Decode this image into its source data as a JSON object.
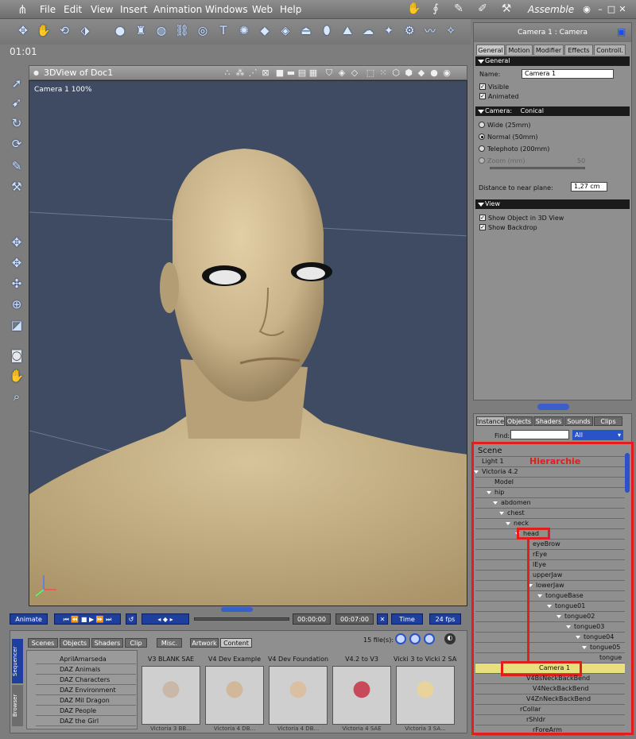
{
  "app": {
    "menu": [
      "File",
      "Edit",
      "View",
      "Insert",
      "Animation",
      "Windows",
      "Web",
      "Help"
    ],
    "room_label": "Assemble",
    "timecode": "01:01"
  },
  "viewport": {
    "title": "3DView of Doc1",
    "camera_label": "Camera 1 100%"
  },
  "properties": {
    "title": "Camera 1 : Camera",
    "tabs": [
      "General",
      "Motion",
      "Modifier",
      "Effects",
      "Controll."
    ],
    "general_section": "General",
    "name_label": "Name:",
    "name_value": "Camera 1",
    "visible_label": "Visible",
    "animated_label": "Animated",
    "camera_section": "Camera:",
    "camera_type": "Conical",
    "lens_options": [
      "Wide (25mm)",
      "Normal (50mm)",
      "Telephoto (200mm)",
      "Zoom (mm)"
    ],
    "zoom_value": "50",
    "near_plane_label": "Distance to near plane:",
    "near_plane_value": "1,27 cm",
    "view_section": "View",
    "show_object_label": "Show Object in 3D View",
    "show_backdrop_label": "Show Backdrop"
  },
  "browser": {
    "tabs": [
      "Instance",
      "Objects",
      "Shaders",
      "Sounds",
      "Clips"
    ],
    "find_label": "Find:",
    "filter_value": "All",
    "annotation": "Hierarchie",
    "tree": [
      {
        "label": "Scene"
      },
      {
        "label": "Light 1"
      },
      {
        "label": "Victoria 4.2"
      },
      {
        "label": "Model"
      },
      {
        "label": "hip"
      },
      {
        "label": "abdomen"
      },
      {
        "label": "chest"
      },
      {
        "label": "neck"
      },
      {
        "label": "head"
      },
      {
        "label": "eyeBrow"
      },
      {
        "label": "rEye"
      },
      {
        "label": "lEye"
      },
      {
        "label": "upperJaw"
      },
      {
        "label": "lowerJaw"
      },
      {
        "label": "tongueBase"
      },
      {
        "label": "tongue01"
      },
      {
        "label": "tongue02"
      },
      {
        "label": "tongue03"
      },
      {
        "label": "tongue04"
      },
      {
        "label": "tongue05"
      },
      {
        "label": "tongue"
      },
      {
        "label": "Camera 1"
      },
      {
        "label": "V4BsNeckBackBend"
      },
      {
        "label": "V4NeckBackBend"
      },
      {
        "label": "V4ZnNeckBackBend"
      },
      {
        "label": "rCollar"
      },
      {
        "label": "rShldr"
      },
      {
        "label": "rForeArm"
      }
    ]
  },
  "timeline": {
    "animate_label": "Animate",
    "current_time": "00:00:00",
    "end_time": "00:07:00",
    "mode": "Time",
    "fps": "24 fps"
  },
  "content": {
    "tabs": [
      "Scenes",
      "Objects",
      "Shaders",
      "Clip",
      "Misc.",
      "Artwork",
      "Content"
    ],
    "file_count": "15 file(s):",
    "side_tabs": [
      "Sequencer",
      "Browser"
    ],
    "libraries": [
      "AprilAmarseda",
      "DAZ Animals",
      "DAZ Characters",
      "DAZ Environment",
      "DAZ Mil Dragon",
      "DAZ People",
      "DAZ the Girl"
    ],
    "items": [
      {
        "name": "V3 BLANK SAE",
        "caption": "Victoria 3 BB..."
      },
      {
        "name": "V4 Dev Example",
        "caption": "Victoria 4 DB..."
      },
      {
        "name": "V4 Dev Foundation",
        "caption": "Victoria 4 DB..."
      },
      {
        "name": "V4.2 to V3",
        "caption": "Victoria 4 SAE"
      },
      {
        "name": "Vicki 3 to Vicki 2 SAE",
        "caption": "Victoria 3 SA..."
      }
    ]
  },
  "colors": {
    "annotation_red": "#e11d1d",
    "viewport_bg": "#3e4b63",
    "skin": "#c8b48d",
    "selected_row": "#e8e07a"
  }
}
